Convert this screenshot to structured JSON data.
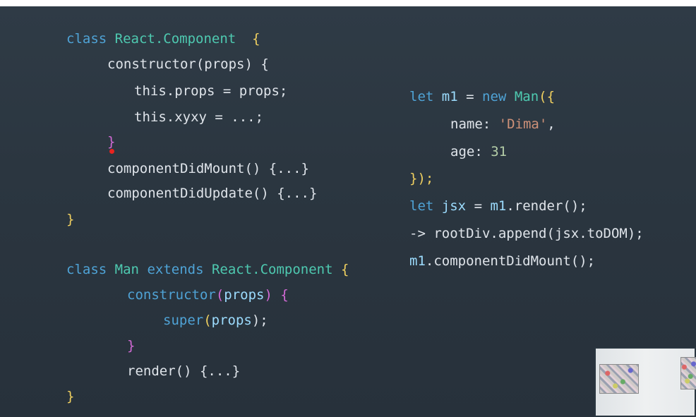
{
  "left_code": {
    "base_class": {
      "kw_class": "class",
      "name_react": "React.",
      "name_component": "Component",
      "open_brace": "{",
      "constructor_line": "constructor(props) {",
      "props_line": "this.props = props;",
      "xyxy_line": "this.xyxy = ...;",
      "close_constructor": "}",
      "did_mount": "componentDidMount() {...}",
      "did_update": "componentDidUpdate() {...}",
      "close_brace": "}"
    },
    "man_class": {
      "kw_class": "class",
      "name_man": "Man",
      "kw_extends": "extends",
      "name_react": "React.",
      "name_component": "Component",
      "open_brace": "{",
      "ctor_kw": "constructor",
      "ctor_open": "(",
      "ctor_param": "props",
      "ctor_close": ") {",
      "super_kw": "super",
      "super_open": "(",
      "super_param": "props",
      "super_close": ");",
      "close_ctor": "}",
      "render_line": "render() {...}",
      "close_brace": "}"
    }
  },
  "right_code": {
    "line1": {
      "kw_let": "let",
      "var": "m1",
      "eq": "=",
      "kw_new": "new",
      "cls": "Man",
      "tail": "({"
    },
    "line2": {
      "key": "name:",
      "value": "'Dima'",
      "comma": ","
    },
    "line3": {
      "key": "age:",
      "value": "31"
    },
    "line4": "});",
    "line5": {
      "kw_let": "let",
      "var": "jsx",
      "eq": "=",
      "obj": "m1",
      "call": ".render();"
    },
    "line6": "-> rootDiv.append(jsx.toDOM);",
    "line7": {
      "obj": "m1",
      "call": ".componentDidMount();"
    }
  },
  "colors": {
    "background": "#2b3640",
    "keyword": "#4fa3d6",
    "class_name": "#4ec9b0",
    "text": "#dfe4ea",
    "string": "#ce9178",
    "number": "#b5cea8",
    "bracket": "#f0d060",
    "cursor_dot": "#e8231f"
  }
}
